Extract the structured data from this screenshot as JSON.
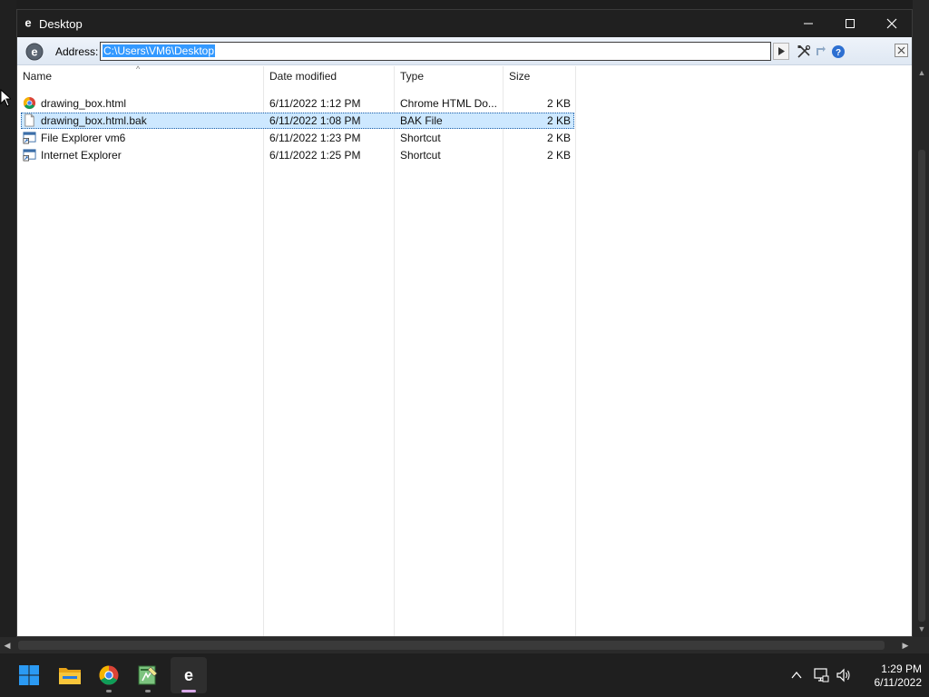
{
  "window": {
    "title": "Desktop",
    "icon": "ie-icon"
  },
  "address_bar": {
    "label": "Address:",
    "value": "C:\\Users\\VM6\\Desktop"
  },
  "list": {
    "columns": {
      "name": "Name",
      "date": "Date modified",
      "type": "Type",
      "size": "Size"
    },
    "rows": [
      {
        "name": "drawing_box.html",
        "date": "6/11/2022 1:12 PM",
        "type": "Chrome HTML Do...",
        "size": "2 KB",
        "icon": "chrome-html-icon",
        "selected": false
      },
      {
        "name": "drawing_box.html.bak",
        "date": "6/11/2022 1:08 PM",
        "type": "BAK File",
        "size": "2 KB",
        "icon": "blank-file-icon",
        "selected": true
      },
      {
        "name": "File Explorer vm6",
        "date": "6/11/2022 1:23 PM",
        "type": "Shortcut",
        "size": "2 KB",
        "icon": "shortcut-icon",
        "selected": false
      },
      {
        "name": "Internet Explorer",
        "date": "6/11/2022 1:25 PM",
        "type": "Shortcut",
        "size": "2 KB",
        "icon": "shortcut-icon",
        "selected": false
      }
    ]
  },
  "taskbar": {
    "items": [
      "start-icon",
      "file-explorer-icon",
      "chrome-icon",
      "notepad-icon",
      "ie-icon"
    ],
    "active_item": "ie-icon",
    "tray_icons": [
      "chevron-up-icon",
      "network-icon",
      "volume-icon"
    ],
    "time": "1:29 PM",
    "date": "6/11/2022"
  },
  "colors": {
    "titlebar": "#202020",
    "selection": "#cde8ff",
    "address_highlight": "#3399ff",
    "taskbar": "#1f1f1f"
  }
}
